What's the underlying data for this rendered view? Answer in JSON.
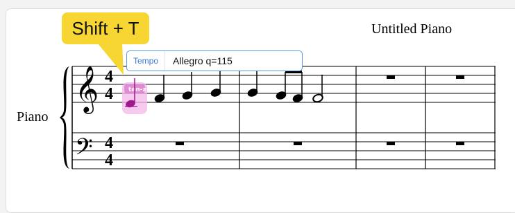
{
  "score": {
    "title": "Untitled Piano",
    "instrument": "Piano",
    "time_signature_top": "4",
    "time_signature_bottom": "4"
  },
  "shortcut_hint": {
    "label": "Shift + T"
  },
  "tempo_popup": {
    "label": "Tempo",
    "value": "Allegro q=115"
  },
  "selected_note": {
    "tag": "tan-z"
  },
  "colors": {
    "shortcut_bg": "#f7d634",
    "popup_border": "#5a97e0",
    "popup_label": "#3b78d8",
    "selection": "#e07fcf"
  }
}
